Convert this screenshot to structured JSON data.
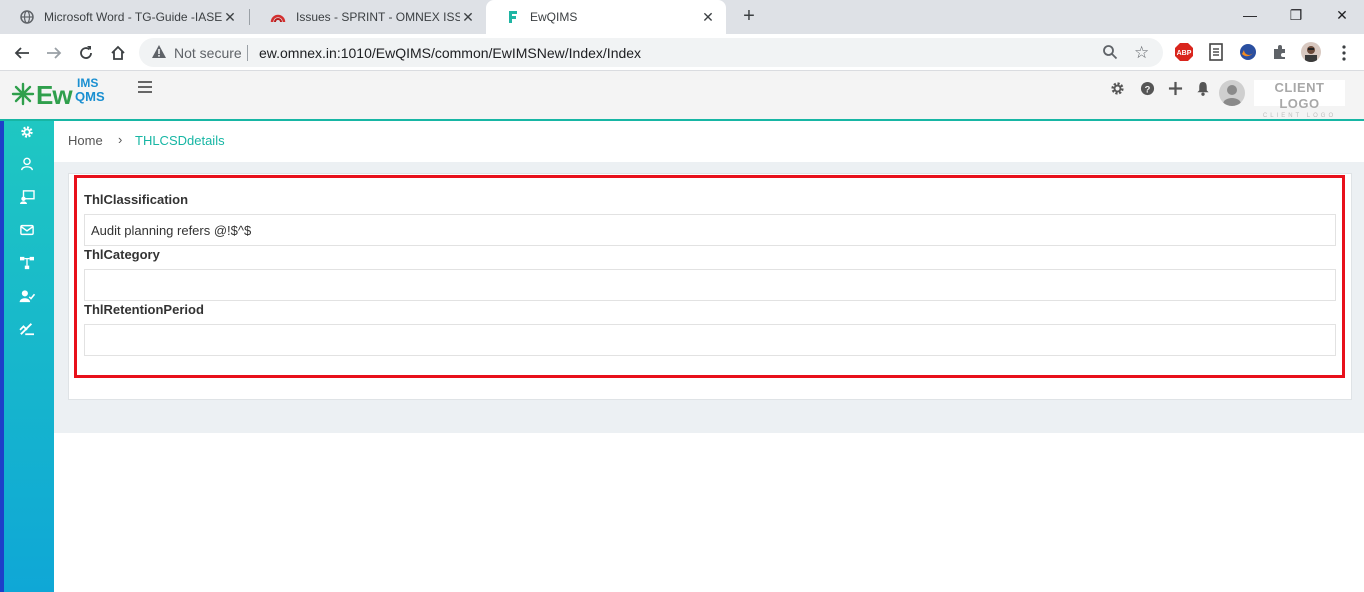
{
  "browser": {
    "tabs": [
      {
        "title": "Microsoft Word - TG-Guide -IASE",
        "icon": "globe-icon"
      },
      {
        "title": "Issues - SPRINT - OMNEX ISSUE T",
        "icon": "jira-icon"
      },
      {
        "title": "EwQIMS",
        "icon": "ewqims-icon"
      }
    ],
    "active_tab": 2,
    "address": {
      "security_label": "Not secure",
      "url": "ew.omnex.in:1010/EwQIMS/common/EwIMSNew/Index/Index"
    },
    "extensions": [
      "abp-icon",
      "document-icon",
      "firefox-like-icon",
      "puzzle-icon",
      "profile-avatar"
    ]
  },
  "app": {
    "logo": {
      "ew": "Ew",
      "ims": "IMS",
      "qms": "QMS"
    },
    "header_icons": [
      "gear-icon",
      "help-icon",
      "plus-icon",
      "bell-icon",
      "user-avatar"
    ],
    "client_logo": {
      "line1": "CLIENT LOGO",
      "line2": "CLIENT LOGO"
    },
    "sidebar_icons": [
      "settings-icon",
      "user-icon",
      "monitor-user-icon",
      "mail-icon",
      "hierarchy-icon",
      "user-check-icon",
      "tools-icon"
    ],
    "breadcrumb": {
      "home": "Home",
      "separator": "›",
      "current": "THLCSDdetails"
    },
    "fields": [
      {
        "label": "ThlClassification",
        "value": "Audit planning refers @!$^$"
      },
      {
        "label": "ThlCategory",
        "value": ""
      },
      {
        "label": "ThlRetentionPeriod",
        "value": ""
      }
    ]
  },
  "colors": {
    "accent": "#17b6a4",
    "highlight_border": "#e8101b",
    "sidebar_top": "#1fc7c2",
    "sidebar_bottom": "#0fa7d6"
  }
}
